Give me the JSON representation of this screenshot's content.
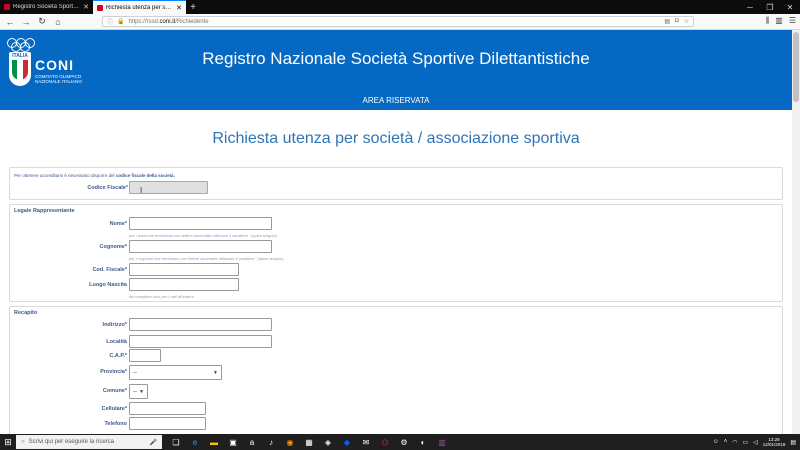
{
  "browser": {
    "tabs": [
      {
        "label": "Registro Società Sportive",
        "active": false
      },
      {
        "label": "Richiesta utenza per società / asso",
        "active": true
      }
    ],
    "url": {
      "prefix": "https://rssd.",
      "host": "coni.it",
      "path": "/Richiedente"
    }
  },
  "header": {
    "logo_name": "CONI",
    "logo_shield_text": "ITALIA",
    "logo_subtitle": "COMITATO OLIMPICO NAZIONALE ITALIANO",
    "title": "Registro Nazionale Società Sportive Dilettantistiche",
    "area": "AREA RISERVATA"
  },
  "page": {
    "title": "Richiesta utenza per società / associazione sportiva",
    "intro": {
      "text": "Per ottenere accreditarsi è necessario disporre del ",
      "bold": "codice fiscale della società."
    },
    "codice_fiscale_label": "Codice Fiscale*",
    "legale": {
      "legend": "Legale Rappresentante",
      "nome_label": "Nome*",
      "nome_hint": "per i nomi che terminano con lettere accentate utilizzare il carattere ' (apice singolo)",
      "cognome_label": "Cognome*",
      "cognome_hint": "per i cognomi che terminano con lettere accentate utilizzare il carattere ' (apice singolo)",
      "cf_label": "Cod. Fiscale*",
      "luogo_label": "Luogo Nascita",
      "luogo_hint": "da compilare solo per i nati all'estero"
    },
    "recapito": {
      "legend": "Recapito",
      "indirizzo_label": "Indirizzo*",
      "localita_label": "Località",
      "cap_label": "C.A.P.*",
      "provincia_label": "Provincia*",
      "provincia_value": "--",
      "comune_label": "Comune*",
      "comune_value": "--",
      "cellulare_label": "Cellulare*",
      "telefono_label": "Telefono"
    }
  },
  "taskbar": {
    "search_placeholder": "Scrivi qui per eseguire la ricerca",
    "time": "13:28",
    "date": "12/01/2018"
  }
}
